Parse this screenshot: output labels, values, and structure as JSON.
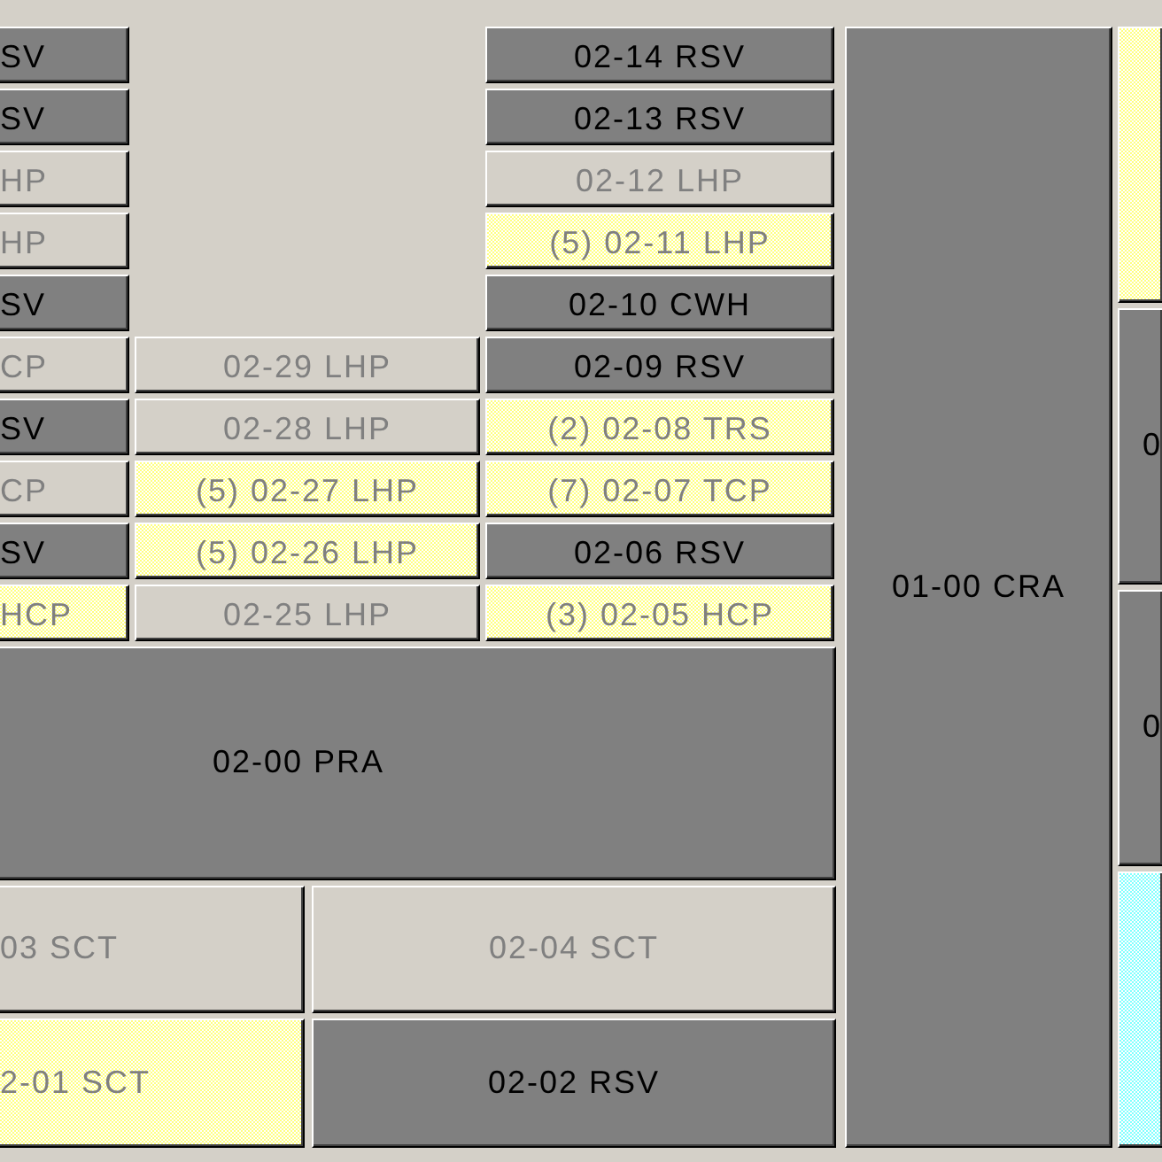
{
  "left_column": [
    {
      "label": "SV",
      "color": "#808080",
      "disabled": false,
      "dotted": false
    },
    {
      "label": "SV",
      "color": "#808080",
      "disabled": false,
      "dotted": false
    },
    {
      "label": "HP",
      "color": "#d4d0c8",
      "disabled": true,
      "dotted": false
    },
    {
      "label": "HP",
      "color": "#d4d0c8",
      "disabled": true,
      "dotted": false
    },
    {
      "label": "SV",
      "color": "#808080",
      "disabled": false,
      "dotted": false
    },
    {
      "label": "CP",
      "color": "#d4d0c8",
      "disabled": true,
      "dotted": false
    },
    {
      "label": "SV",
      "color": "#808080",
      "disabled": false,
      "dotted": false
    },
    {
      "label": "CP",
      "color": "#d4d0c8",
      "disabled": true,
      "dotted": false
    },
    {
      "label": "SV",
      "color": "#808080",
      "disabled": false,
      "dotted": false
    },
    {
      "label": "HCP",
      "color": "#ffff80",
      "disabled": true,
      "dotted": true
    }
  ],
  "middle_column": [
    {
      "label": "02-29 LHP",
      "color": "#d4d0c8",
      "disabled": true,
      "dotted": false
    },
    {
      "label": "02-28 LHP",
      "color": "#d4d0c8",
      "disabled": true,
      "dotted": false
    },
    {
      "label": "(5) 02-27 LHP",
      "color": "#ffff80",
      "disabled": true,
      "dotted": true
    },
    {
      "label": "(5) 02-26 LHP",
      "color": "#ffff80",
      "disabled": true,
      "dotted": true
    },
    {
      "label": "02-25 LHP",
      "color": "#d4d0c8",
      "disabled": true,
      "dotted": false
    }
  ],
  "right_column": [
    {
      "label": "02-14 RSV",
      "color": "#808080",
      "disabled": false,
      "dotted": false
    },
    {
      "label": "02-13 RSV",
      "color": "#808080",
      "disabled": false,
      "dotted": false
    },
    {
      "label": "02-12 LHP",
      "color": "#d4d0c8",
      "disabled": true,
      "dotted": false
    },
    {
      "label": "(5) 02-11 LHP",
      "color": "#ffff80",
      "disabled": true,
      "dotted": true
    },
    {
      "label": "02-10 CWH",
      "color": "#808080",
      "disabled": false,
      "dotted": false
    },
    {
      "label": "02-09 RSV",
      "color": "#808080",
      "disabled": false,
      "dotted": false
    },
    {
      "label": "(2) 02-08 TRS",
      "color": "#ffff80",
      "disabled": true,
      "dotted": true
    },
    {
      "label": "(7) 02-07 TCP",
      "color": "#ffff80",
      "disabled": true,
      "dotted": true
    },
    {
      "label": "02-06 RSV",
      "color": "#808080",
      "disabled": false,
      "dotted": false
    },
    {
      "label": "(3) 02-05 HCP",
      "color": "#ffff80",
      "disabled": true,
      "dotted": true
    }
  ],
  "wide_button": {
    "label": "02-00 PRA",
    "color": "#808080",
    "disabled": false,
    "dotted": false
  },
  "bottom_buttons": [
    {
      "label": "03 SCT",
      "color": "#d4d0c8",
      "disabled": true,
      "dotted": false
    },
    {
      "label": "02-04 SCT",
      "color": "#d4d0c8",
      "disabled": true,
      "dotted": false
    },
    {
      "label": "2-01 SCT",
      "color": "#ffff80",
      "disabled": true,
      "dotted": true
    },
    {
      "label": "02-02 RSV",
      "color": "#808080",
      "disabled": false,
      "dotted": false
    }
  ],
  "tall_button": {
    "label": "01-00 CRA",
    "color": "#808080",
    "disabled": false,
    "dotted": false
  },
  "edge_column": [
    {
      "color": "#ffff80",
      "disabled": true,
      "dotted": true
    },
    {
      "label": "0",
      "color": "#808080",
      "disabled": false,
      "dotted": false
    },
    {
      "label": "0",
      "color": "#808080",
      "disabled": false,
      "dotted": false
    },
    {
      "color": "#80ffff",
      "disabled": true,
      "dotted": true
    }
  ]
}
